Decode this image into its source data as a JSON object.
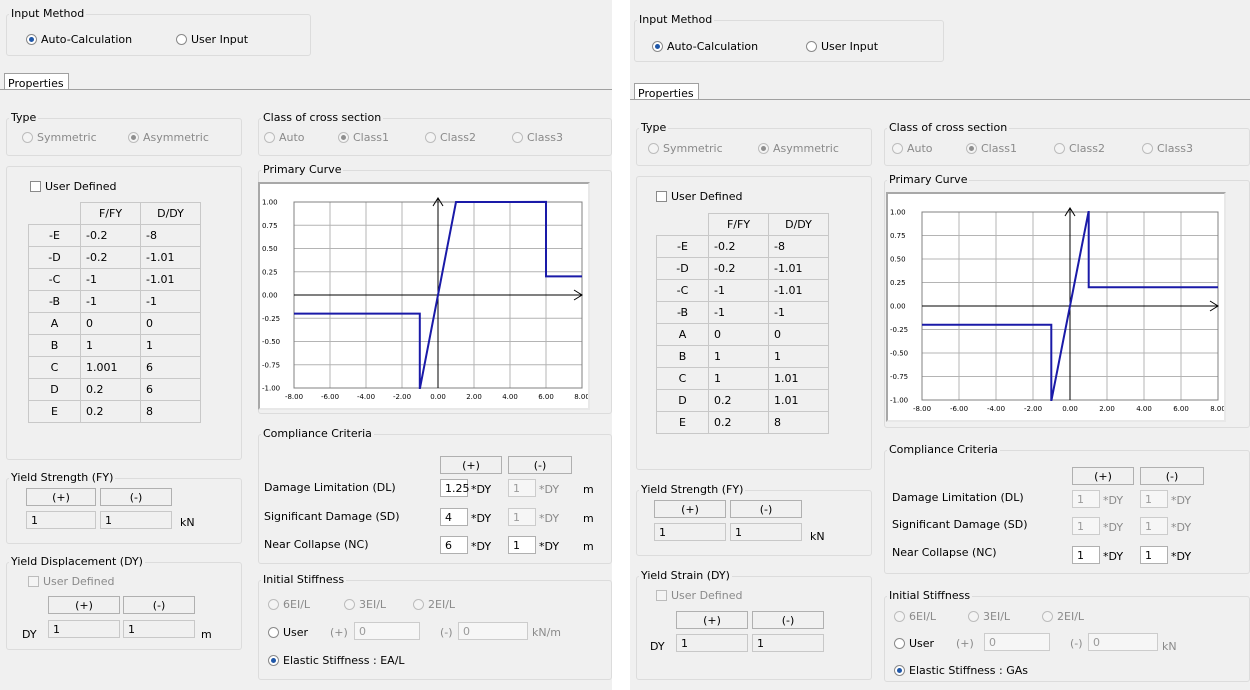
{
  "panels": [
    {
      "input_method": {
        "title": "Input Method",
        "options": [
          "Auto-Calculation",
          "User Input"
        ],
        "selected": 0
      },
      "tab": "Properties",
      "type": {
        "title": "Type",
        "options": [
          "Symmetric",
          "Asymmetric"
        ],
        "selected": 1
      },
      "class_section": {
        "title": "Class of cross section",
        "options": [
          "Auto",
          "Class1",
          "Class2",
          "Class3"
        ],
        "selected": 1
      },
      "user_defined_label": "User Defined",
      "table": {
        "headers": [
          "F/FY",
          "D/DY"
        ],
        "rows": [
          {
            "label": "-E",
            "f": "-0.2",
            "d": "-8"
          },
          {
            "label": "-D",
            "f": "-0.2",
            "d": "-1.01"
          },
          {
            "label": "-C",
            "f": "-1",
            "d": "-1.01"
          },
          {
            "label": "-B",
            "f": "-1",
            "d": "-1"
          },
          {
            "label": "A",
            "f": "0",
            "d": "0"
          },
          {
            "label": "B",
            "f": "1",
            "d": "1"
          },
          {
            "label": "C",
            "f": "1.001",
            "d": "6"
          },
          {
            "label": "D",
            "f": "0.2",
            "d": "6"
          },
          {
            "label": "E",
            "f": "0.2",
            "d": "8"
          }
        ]
      },
      "yield_strength": {
        "title": "Yield Strength (FY)",
        "plus_label": "(+)",
        "minus_label": "(-)",
        "plus": "1",
        "minus": "1",
        "unit": "kN"
      },
      "yield_disp": {
        "title": "Yield Displacement (DY)",
        "user_defined": "User Defined",
        "plus_label": "(+)",
        "minus_label": "(-)",
        "row_label": "DY",
        "plus": "1",
        "minus": "1",
        "unit": "m"
      },
      "chart_data": {
        "type": "line",
        "title": "Primary Curve",
        "x_ticks": [
          "-8.00",
          "-6.00",
          "-4.00",
          "-2.00",
          "0.00",
          "2.00",
          "4.00",
          "6.00",
          "8.00"
        ],
        "y_ticks": [
          "1.00",
          "0.75",
          "0.50",
          "0.25",
          "0.00",
          "-0.25",
          "-0.50",
          "-0.75",
          "-1.00"
        ],
        "xlim": [
          -8,
          8
        ],
        "ylim": [
          -1,
          1
        ],
        "series": [
          {
            "color": "#1a1aa8",
            "x": [
              -8,
              -1.01,
              -1.01,
              -1,
              0,
              1,
              6,
              6,
              8
            ],
            "y": [
              -0.2,
              -0.2,
              -1,
              -1,
              0,
              1,
              1.001,
              0.2,
              0.2
            ]
          }
        ]
      },
      "compliance": {
        "title": "Compliance Criteria",
        "plus_label": "(+)",
        "minus_label": "(-)",
        "rows": [
          {
            "label": "Damage Limitation (DL)",
            "plus": "1.25",
            "minus": "1",
            "plus_enabled": true,
            "minus_enabled": false,
            "unit": "m"
          },
          {
            "label": "Significant Damage (SD)",
            "plus": "4",
            "minus": "1",
            "plus_enabled": true,
            "minus_enabled": false,
            "unit": "m"
          },
          {
            "label": "Near Collapse (NC)",
            "plus": "6",
            "minus": "1",
            "plus_enabled": true,
            "minus_enabled": true,
            "unit": "m"
          }
        ],
        "suffix": "*DY"
      },
      "initial_stiffness": {
        "title": "Initial Stiffness",
        "options": [
          "6EI/L",
          "3EI/L",
          "2EI/L"
        ],
        "user_label": "User",
        "plus_prefix": "(+)",
        "minus_prefix": "(-)",
        "plus": "0",
        "minus": "0",
        "unit": "kN/m",
        "elastic_label": "Elastic Stiffness : EA/L"
      }
    },
    {
      "input_method": {
        "title": "Input Method",
        "options": [
          "Auto-Calculation",
          "User Input"
        ],
        "selected": 0
      },
      "tab": "Properties",
      "type": {
        "title": "Type",
        "options": [
          "Symmetric",
          "Asymmetric"
        ],
        "selected": 1
      },
      "class_section": {
        "title": "Class of cross section",
        "options": [
          "Auto",
          "Class1",
          "Class2",
          "Class3"
        ],
        "selected": 1
      },
      "user_defined_label": "User Defined",
      "table": {
        "headers": [
          "F/FY",
          "D/DY"
        ],
        "rows": [
          {
            "label": "-E",
            "f": "-0.2",
            "d": "-8"
          },
          {
            "label": "-D",
            "f": "-0.2",
            "d": "-1.01"
          },
          {
            "label": "-C",
            "f": "-1",
            "d": "-1.01"
          },
          {
            "label": "-B",
            "f": "-1",
            "d": "-1"
          },
          {
            "label": "A",
            "f": "0",
            "d": "0"
          },
          {
            "label": "B",
            "f": "1",
            "d": "1"
          },
          {
            "label": "C",
            "f": "1",
            "d": "1.01"
          },
          {
            "label": "D",
            "f": "0.2",
            "d": "1.01"
          },
          {
            "label": "E",
            "f": "0.2",
            "d": "8"
          }
        ]
      },
      "yield_strength": {
        "title": "Yield Strength (FY)",
        "plus_label": "(+)",
        "minus_label": "(-)",
        "plus": "1",
        "minus": "1",
        "unit": "kN"
      },
      "yield_disp": {
        "title": "Yield Strain (DY)",
        "user_defined": "User Defined",
        "plus_label": "(+)",
        "minus_label": "(-)",
        "row_label": "DY",
        "plus": "1",
        "minus": "1",
        "unit": ""
      },
      "chart_data": {
        "type": "line",
        "title": "Primary Curve",
        "x_ticks": [
          "-8.00",
          "-6.00",
          "-4.00",
          "-2.00",
          "0.00",
          "2.00",
          "4.00",
          "6.00",
          "8.00"
        ],
        "y_ticks": [
          "1.00",
          "0.75",
          "0.50",
          "0.25",
          "0.00",
          "-0.25",
          "-0.50",
          "-0.75",
          "-1.00"
        ],
        "xlim": [
          -8,
          8
        ],
        "ylim": [
          -1,
          1
        ],
        "series": [
          {
            "color": "#1a1aa8",
            "x": [
              -8,
              -1.01,
              -1.01,
              -1,
              0,
              1,
              1.01,
              1.01,
              8
            ],
            "y": [
              -0.2,
              -0.2,
              -1,
              -1,
              0,
              1,
              1,
              0.2,
              0.2
            ]
          }
        ]
      },
      "compliance": {
        "title": "Compliance Criteria",
        "plus_label": "(+)",
        "minus_label": "(-)",
        "rows": [
          {
            "label": "Damage Limitation (DL)",
            "plus": "1",
            "minus": "1",
            "plus_enabled": false,
            "minus_enabled": false,
            "unit": ""
          },
          {
            "label": "Significant Damage (SD)",
            "plus": "1",
            "minus": "1",
            "plus_enabled": false,
            "minus_enabled": false,
            "unit": ""
          },
          {
            "label": "Near Collapse (NC)",
            "plus": "1",
            "minus": "1",
            "plus_enabled": true,
            "minus_enabled": true,
            "unit": ""
          }
        ],
        "suffix": "*DY"
      },
      "initial_stiffness": {
        "title": "Initial Stiffness",
        "options": [
          "6EI/L",
          "3EI/L",
          "2EI/L"
        ],
        "user_label": "User",
        "plus_prefix": "(+)",
        "minus_prefix": "(-)",
        "plus": "0",
        "minus": "0",
        "unit": "kN",
        "elastic_label": "Elastic Stiffness : GAs"
      }
    }
  ]
}
